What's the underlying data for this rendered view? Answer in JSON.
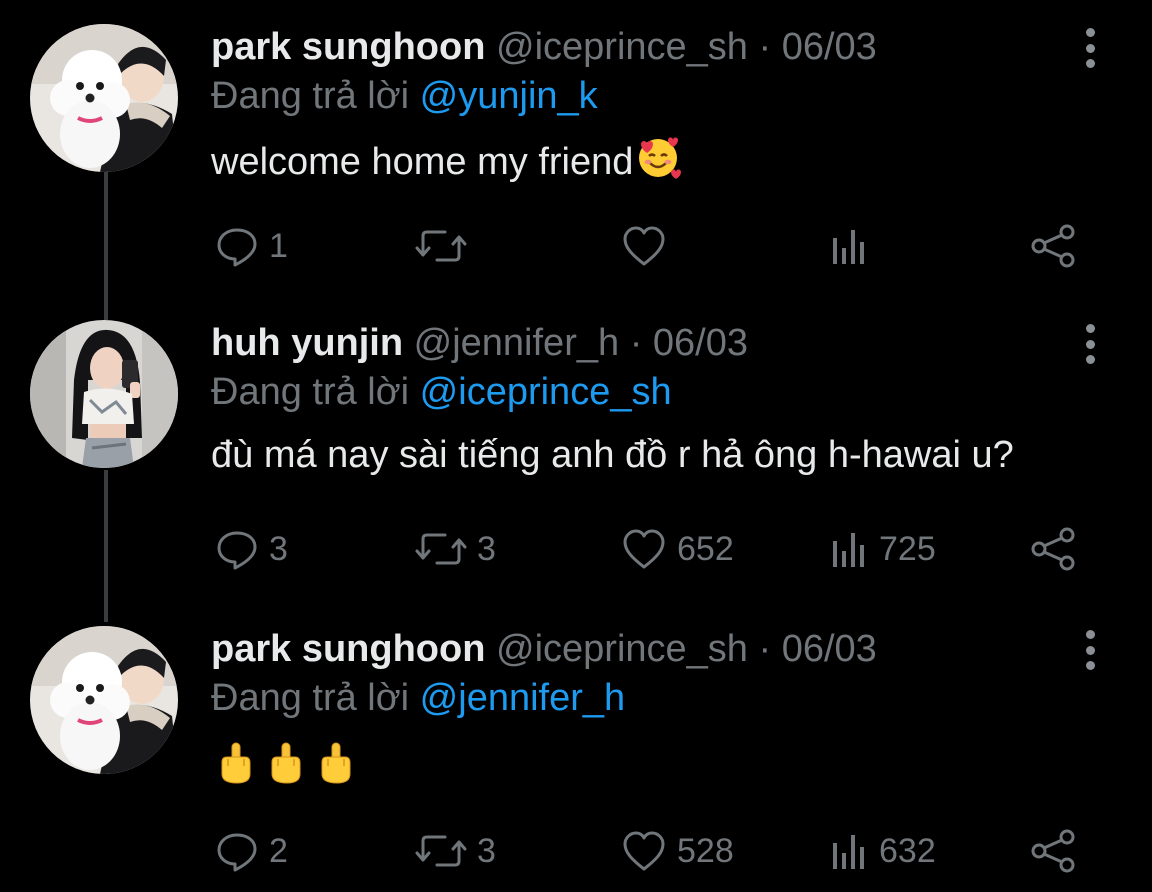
{
  "tweets": [
    {
      "name": "park sunghoon",
      "handle": "@iceprince_sh",
      "separator": "·",
      "date": "06/03",
      "reply_prefix": "Đang trả lời",
      "reply_to": "@yunjin_k",
      "text": "welcome home my friend",
      "emoji": "smiling-face-with-hearts",
      "stats": {
        "replies": "1",
        "retweets": "",
        "likes": "",
        "views": ""
      }
    },
    {
      "name": "huh yunjin",
      "handle": "@jennifer_h",
      "separator": "·",
      "date": "06/03",
      "reply_prefix": "Đang trả lời",
      "reply_to": "@iceprince_sh",
      "text": "đù má nay sài tiếng anh đồ r hả ông h-hawai u?",
      "stats": {
        "replies": "3",
        "retweets": "3",
        "likes": "652",
        "views": "725"
      }
    },
    {
      "name": "park sunghoon",
      "handle": "@iceprince_sh",
      "separator": "·",
      "date": "06/03",
      "reply_prefix": "Đang trả lời",
      "reply_to": "@jennifer_h",
      "text_emoji": [
        "middle-finger",
        "middle-finger",
        "middle-finger"
      ],
      "stats": {
        "replies": "2",
        "retweets": "3",
        "likes": "528",
        "views": "632"
      }
    }
  ],
  "icons": {
    "reply": "speech-bubble-icon",
    "retweet": "retweet-icon",
    "like": "heart-icon",
    "views": "bar-chart-icon",
    "share": "share-icon",
    "more": "vertical-dots-icon"
  },
  "colors": {
    "background": "#000000",
    "primary_text": "#e7e9ea",
    "secondary_text": "#71767b",
    "mention": "#1d9bf0"
  }
}
